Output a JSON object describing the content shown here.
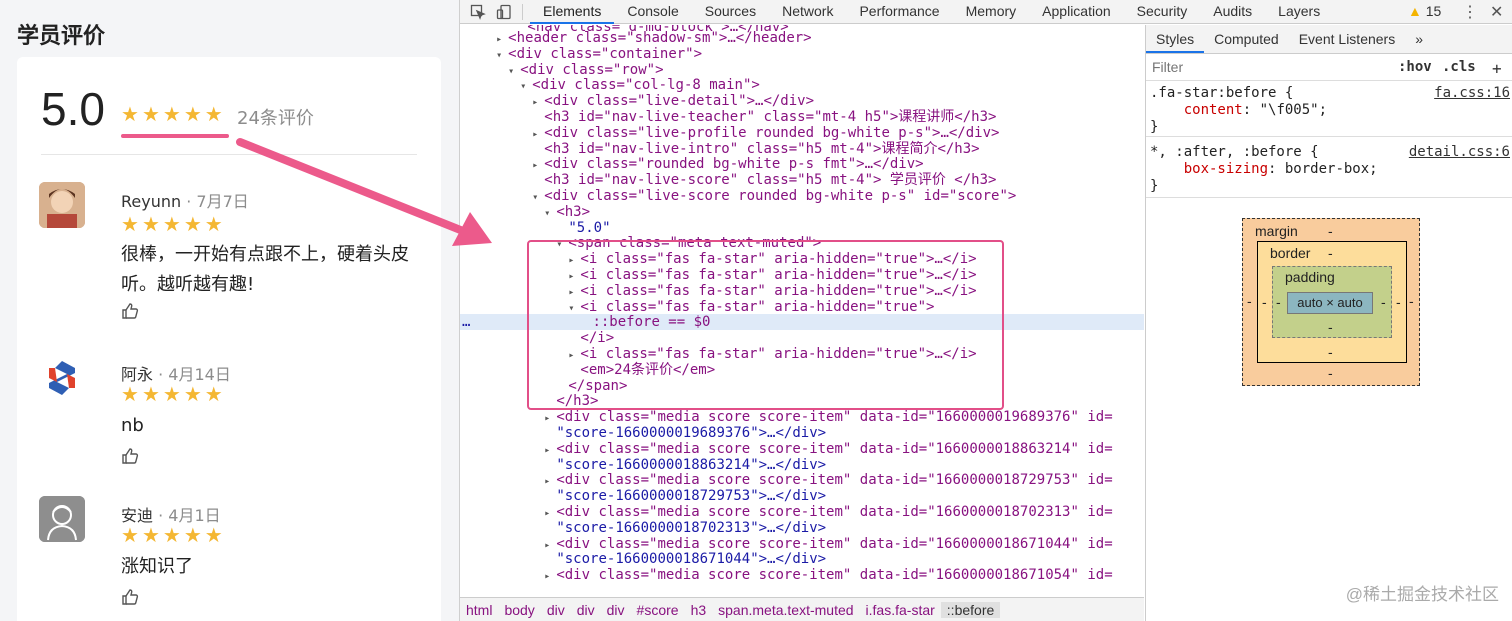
{
  "left": {
    "title": "学员评价",
    "score": "5.0",
    "count": "24条评价",
    "reviews": [
      {
        "name": "Reyunn",
        "sep": " · ",
        "date": "7月7日",
        "text": "很棒，一开始有点跟不上，硬着头皮听。越听越有趣!",
        "stars": 5
      },
      {
        "name": "阿永",
        "sep": " · ",
        "date": "4月14日",
        "text": "nb",
        "stars": 5
      },
      {
        "name": "安迪",
        "sep": " · ",
        "date": "4月1日",
        "text": "涨知识了",
        "stars": 5
      }
    ]
  },
  "devtools": {
    "tabs": [
      "Elements",
      "Console",
      "Sources",
      "Network",
      "Performance",
      "Memory",
      "Application",
      "Security",
      "Audits",
      "Layers"
    ],
    "active_tab": "Elements",
    "warning_count": "15",
    "breadcrumbs": [
      "html",
      "body",
      "div",
      "div",
      "div",
      "#score",
      "h3",
      "span.meta.text-muted",
      "i.fas.fa-star",
      "::before"
    ],
    "elements": [
      {
        "t": "▸ ",
        "html": "<header class=\"shadow-sm\">…</header>"
      },
      {
        "t": "▾ ",
        "html": "<div class=\"container\">"
      },
      {
        "t": "▾ ",
        "html": "<div class=\"row\">"
      },
      {
        "t": "▾ ",
        "html": "<div class=\"col-lg-8 main\">"
      },
      {
        "t": "▸ ",
        "html": "<div class=\"live-detail\">…</div>"
      },
      {
        "t": "",
        "html": "<h3 id=\"nav-live-teacher\" class=\"mt-4 h5\">课程讲师</h3>"
      },
      {
        "t": "▸ ",
        "html": "<div class=\"live-profile rounded bg-white p-s\">…</div>"
      },
      {
        "t": "",
        "html": "<h3 id=\"nav-live-intro\" class=\"h5 mt-4\">课程简介</h3>"
      },
      {
        "t": "▸ ",
        "html": "<div class=\"rounded bg-white p-s fmt\">…</div>"
      },
      {
        "t": "",
        "html": "<h3 id=\"nav-live-score\" class=\"h5 mt-4\"> 学员评价 </h3>"
      },
      {
        "t": "▾ ",
        "html": "<div class=\"live-score rounded bg-white p-s\" id=\"score\">"
      },
      {
        "t": "▾ ",
        "html": "<h3>"
      },
      {
        "t": "",
        "html": "\"5.0\""
      },
      {
        "t": "▾ ",
        "html": "<span class=\"meta text-muted\">"
      },
      {
        "t": "▸ ",
        "html": "<i class=\"fas fa-star\" aria-hidden=\"true\">…</i>"
      },
      {
        "t": "▸ ",
        "html": "<i class=\"fas fa-star\" aria-hidden=\"true\">…</i>"
      },
      {
        "t": "▸ ",
        "html": "<i class=\"fas fa-star\" aria-hidden=\"true\">…</i>"
      },
      {
        "t": "▾ ",
        "html": "<i class=\"fas fa-star\" aria-hidden=\"true\">"
      },
      {
        "t": "",
        "html": "::before == $0"
      },
      {
        "t": "",
        "html": "</i>"
      },
      {
        "t": "▸ ",
        "html": "<i class=\"fas fa-star\" aria-hidden=\"true\">…</i>"
      },
      {
        "t": "",
        "html": "<em>24条评价</em>"
      },
      {
        "t": "",
        "html": "</span>"
      },
      {
        "t": "",
        "html": "</h3>"
      },
      {
        "t": "▸ ",
        "html": "<div class=\"media score score-item\" data-id=\"1660000019689376\" id="
      },
      {
        "t": "",
        "html": "\"score-1660000019689376\">…</div>"
      },
      {
        "t": "▸ ",
        "html": "<div class=\"media score score-item\" data-id=\"1660000018863214\" id="
      },
      {
        "t": "",
        "html": "\"score-1660000018863214\">…</div>"
      },
      {
        "t": "▸ ",
        "html": "<div class=\"media score score-item\" data-id=\"1660000018729753\" id="
      },
      {
        "t": "",
        "html": "\"score-1660000018729753\">…</div>"
      },
      {
        "t": "▸ ",
        "html": "<div class=\"media score score-item\" data-id=\"1660000018702313\" id="
      },
      {
        "t": "",
        "html": "\"score-1660000018702313\">…</div>"
      },
      {
        "t": "▸ ",
        "html": "<div class=\"media score score-item\" data-id=\"1660000018671044\" id="
      },
      {
        "t": "",
        "html": "\"score-1660000018671044\">…</div>"
      },
      {
        "t": "▸ ",
        "html": "<div class=\"media score score-item\" data-id=\"1660000018671054\" id="
      }
    ],
    "styles": {
      "tabs": [
        "Styles",
        "Computed",
        "Event Listeners",
        "»"
      ],
      "filter_placeholder": "Filter",
      "hov": ":hov",
      "cls": ".cls",
      "add": "+",
      "rules": [
        {
          "selector": ".fa-star:before {",
          "prop": "content",
          "value": "\"\\f005\";",
          "source": "fa.css:16"
        },
        {
          "selector": "*, :after, :before {",
          "prop": "box-sizing",
          "value": "border-box;",
          "source": "detail.css:6"
        }
      ],
      "box_model": {
        "margin": "margin",
        "border": "border",
        "padding": "padding",
        "content": "auto × auto",
        "dash": "-"
      }
    }
  },
  "watermark": "@稀土掘金技术社区",
  "colors": {
    "star": "#f4b733",
    "highlight": "#e24f88",
    "link": "#1a73e8"
  }
}
